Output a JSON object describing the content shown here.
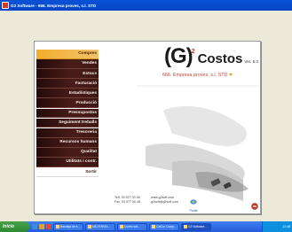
{
  "window": {
    "title": "G2 Software - 666. Empresa proves, s.l. STD"
  },
  "menu": [
    {
      "label": "Compres",
      "state": "active"
    },
    {
      "label": "Vendes",
      "state": "dark"
    },
    {
      "label": "Estocs",
      "state": "dark"
    },
    {
      "label": "Facturació",
      "state": "dark"
    },
    {
      "label": "Estadístiques",
      "state": "dark"
    },
    {
      "label": "Producció",
      "state": "dark"
    },
    {
      "label": "Pressupostos",
      "state": "dark"
    },
    {
      "label": "Seguiment treballs",
      "state": "dark"
    },
    {
      "label": "Tresoreria",
      "state": "dark"
    },
    {
      "label": "Recursos humans",
      "state": "dark"
    },
    {
      "label": "Qualitat",
      "state": "dark"
    },
    {
      "label": "Utilitats i contr.",
      "state": "dark"
    },
    {
      "label": "Sortir",
      "state": "light"
    }
  ],
  "brand": {
    "logo": "(G)",
    "superscript": "2",
    "product": "Costos",
    "version": "Ver. 6.3",
    "company": "666. Empresa proves, s.l. STD"
  },
  "contact": {
    "tel": "Telf. 93 577 00 48",
    "fax": "Fax. 93 577 00 48",
    "web": "www.g2soft.com",
    "email": "g2soft@g2soft.com",
    "portal": "Portal"
  },
  "taskbar": {
    "start": "Inicio",
    "tasks": [
      "Bandeja de e...",
      "MiCi ENVIA...",
      "Cuneo sof...",
      "CalCur Comp...",
      "G2 Software..."
    ],
    "tray": "11:48"
  },
  "colors": {
    "accent": "#f4ac2c",
    "menu_dark": "#3d1612",
    "company_text": "#c7443a"
  }
}
